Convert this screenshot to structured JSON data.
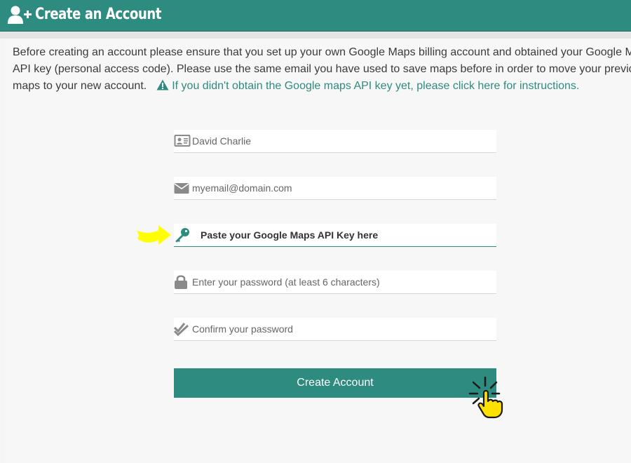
{
  "header": {
    "title": "Create an Account",
    "icon": "user-plus-icon"
  },
  "intro": {
    "line1": "Before creating an account please ensure that you set up your own Google Maps billing account and obtained your Google Maps",
    "line2": "API key (personal access code). Please use the same email you have used to save maps before in order to move your previous",
    "line3": "maps to your new account.",
    "api_link": "If you didn't obtain the Google maps API key yet, please click here for instructions."
  },
  "form": {
    "name": {
      "placeholder": "David Charlie",
      "icon": "id-card-icon"
    },
    "email": {
      "placeholder": "myemail@domain.com",
      "icon": "envelope-icon"
    },
    "api_key": {
      "placeholder": "Paste your Google Maps API Key here",
      "icon": "key-icon"
    },
    "password": {
      "placeholder": "Enter your password (at least 6 characters)",
      "icon": "lock-icon"
    },
    "confirm": {
      "placeholder": "Confirm your password",
      "icon": "double-check-icon"
    },
    "submit_label": "Create Account"
  },
  "colors": {
    "accent": "#2e8b7f",
    "highlight_arrow": "#ffff00"
  }
}
